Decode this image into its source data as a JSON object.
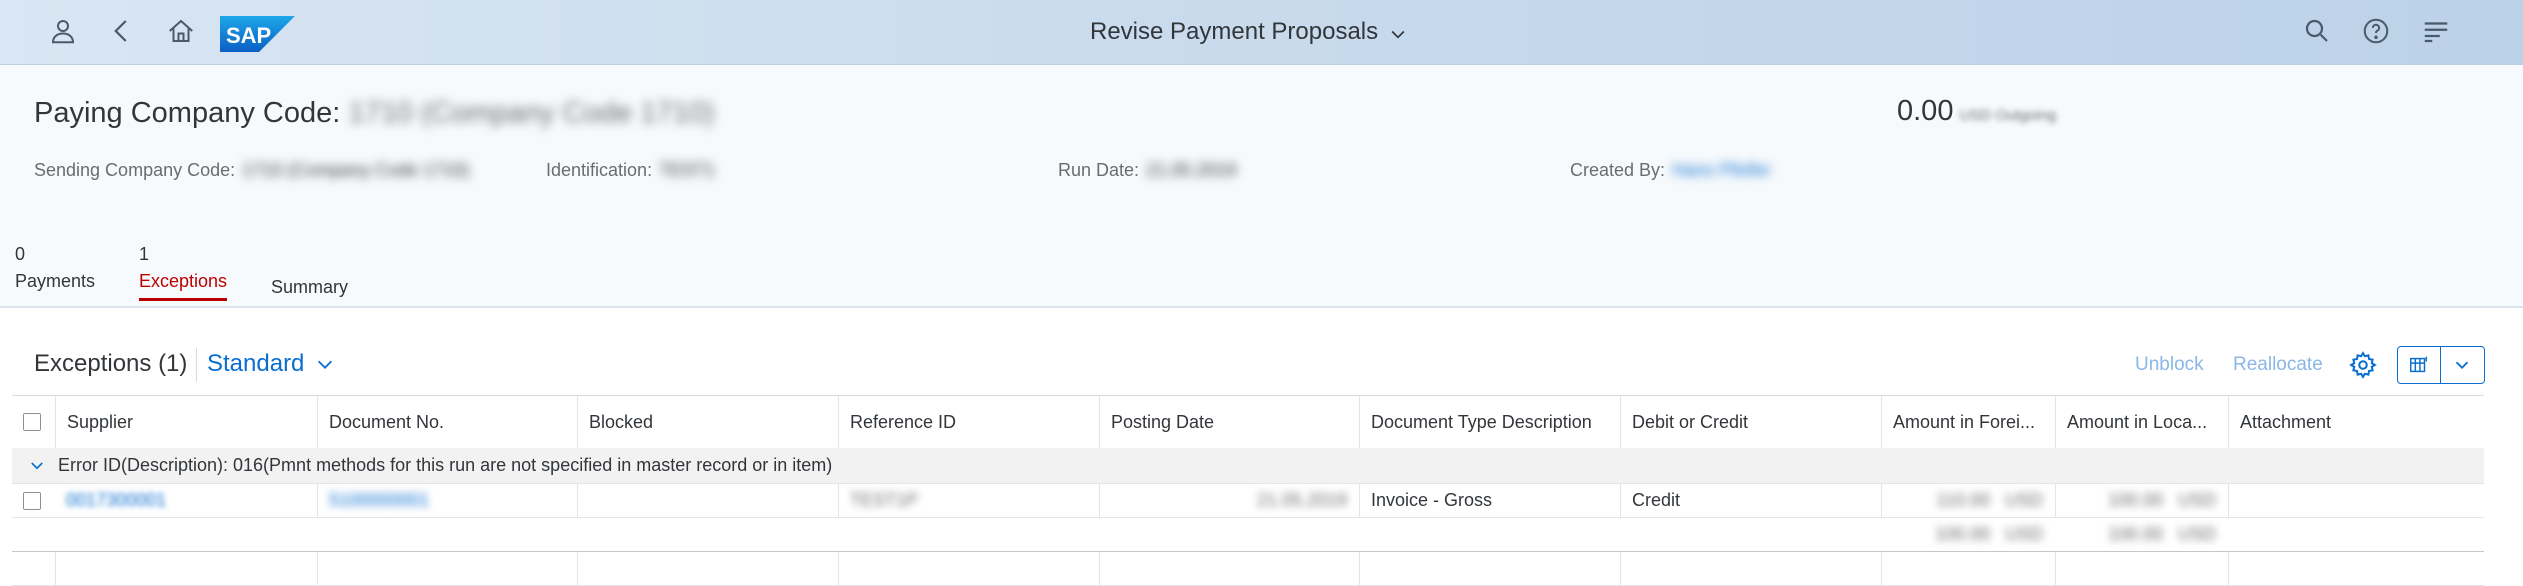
{
  "shell": {
    "title": "Revise Payment Proposals",
    "icons": [
      "user-icon",
      "back-icon",
      "home-icon",
      "sap-logo",
      "search-icon",
      "help-icon",
      "notifications-icon"
    ]
  },
  "header": {
    "title_label": "Paying Company Code:",
    "title_value": "1710 (Company Code 1710)",
    "kpi_value": "0.00",
    "kpi_unit": "USD Outgoing",
    "attributes": {
      "sending_label": "Sending Company Code:",
      "sending_value": "1710 (Company Code 1710)",
      "identification_label": "Identification:",
      "identification_value": "TEST1",
      "run_date_label": "Run Date:",
      "run_date_value": "21.05.2019",
      "created_by_label": "Created By:",
      "created_by_value": "Hans Pfeifer"
    }
  },
  "tabs": [
    {
      "count": "0",
      "label": "Payments"
    },
    {
      "count": "1",
      "label": "Exceptions",
      "active": true
    },
    {
      "count": "",
      "label": "Summary"
    }
  ],
  "toolbar": {
    "title": "Exceptions (1)",
    "variant": "Standard",
    "unblock": "Unblock",
    "reallocate": "Reallocate"
  },
  "table": {
    "columns": [
      "Supplier",
      "Document No.",
      "Blocked",
      "Reference ID",
      "Posting Date",
      "Document Type Description",
      "Debit or Credit",
      "Amount in Forei...",
      "Amount in Loca...",
      "Attachment"
    ],
    "group_header": "Error ID(Description): 016(Pmnt methods for this run are not specified in master record or in item)",
    "rows": [
      {
        "supplier": "0017300001",
        "document_no": "5100000001",
        "blocked": "",
        "reference_id": "TEST1P",
        "posting_date": "21.05.2019",
        "doc_type": "Invoice - Gross",
        "debit_credit": "Credit",
        "amount_foreign": "110.00   USD",
        "amount_local": "100.00   USD",
        "attachment": ""
      }
    ],
    "totals": {
      "amount_foreign": "100.00   USD",
      "amount_local": "100.00   USD"
    }
  },
  "colors": {
    "shell_bg": "#c8daec",
    "accent": "#0a6ed1",
    "active_tab": "#bb0000",
    "disabled_button": "#8ab7e6"
  }
}
